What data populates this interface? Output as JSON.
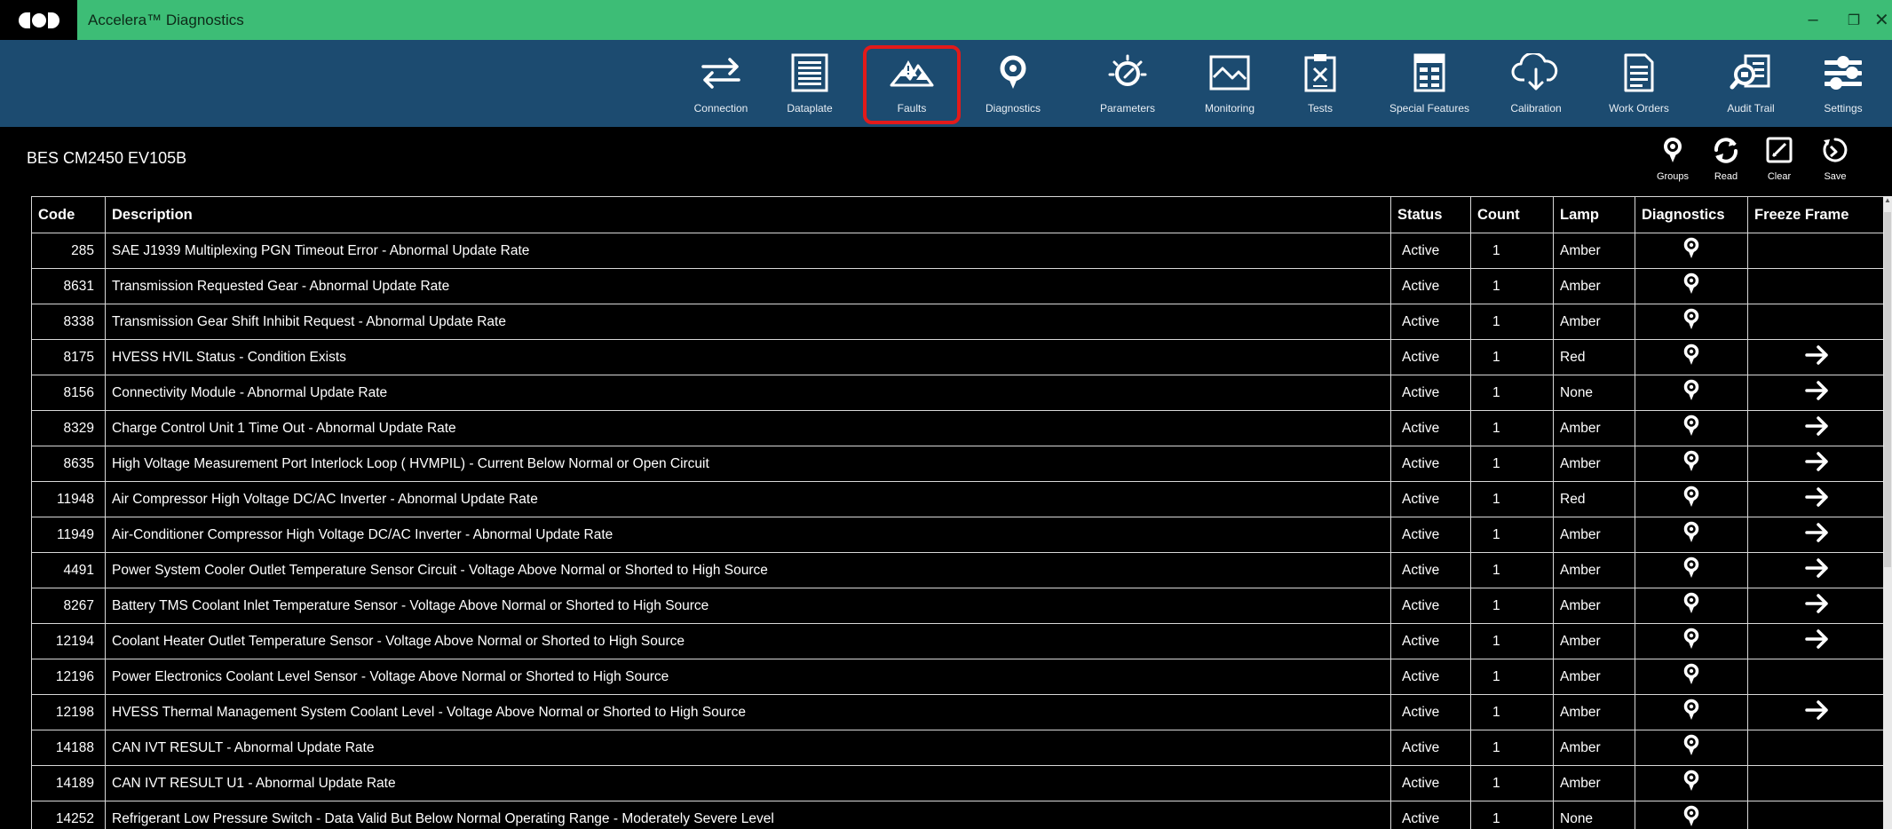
{
  "window": {
    "title": "Accelera™ Diagnostics",
    "controls": {
      "minimize": "–",
      "maximize": "❐",
      "close": "✕"
    }
  },
  "toolbar": {
    "items": [
      {
        "label": "Connection",
        "icon": "connection-arrows-icon"
      },
      {
        "label": "Dataplate",
        "icon": "dataplate-icon"
      },
      {
        "label": "Faults",
        "icon": "faults-icon",
        "active": true
      },
      {
        "label": "Diagnostics",
        "icon": "diagnostics-icon"
      },
      {
        "label": "Parameters",
        "icon": "parameters-gauge-icon"
      },
      {
        "label": "Monitoring",
        "icon": "monitoring-chart-icon"
      },
      {
        "label": "Tests",
        "icon": "tests-clipboard-icon"
      },
      {
        "label": "Special Features",
        "icon": "special-features-icon"
      },
      {
        "label": "Calibration",
        "icon": "calibration-cloud-icon"
      },
      {
        "label": "Work Orders",
        "icon": "work-orders-icon"
      },
      {
        "label": "Audit Trail",
        "icon": "audit-trail-icon"
      },
      {
        "label": "Settings",
        "icon": "settings-sliders-icon"
      }
    ],
    "highlight_color": "#e31a1a"
  },
  "subheader": {
    "ecm_label": "BES CM2450 EV105B",
    "actions": [
      {
        "label": "Groups",
        "icon": "groups-icon"
      },
      {
        "label": "Read",
        "icon": "refresh-icon"
      },
      {
        "label": "Clear",
        "icon": "clear-icon"
      },
      {
        "label": "Save",
        "icon": "save-icon"
      }
    ]
  },
  "table": {
    "headers": [
      "Code",
      "Description",
      "Status",
      "Count",
      "Lamp",
      "Diagnostics",
      "Freeze Frame"
    ],
    "rows": [
      {
        "code": "285",
        "description": "SAE J1939 Multiplexing PGN Timeout Error - Abnormal Update Rate",
        "status": "Active",
        "count": "1",
        "lamp": "Amber",
        "freeze_frame": false
      },
      {
        "code": "8631",
        "description": "Transmission Requested Gear - Abnormal Update Rate",
        "status": "Active",
        "count": "1",
        "lamp": "Amber",
        "freeze_frame": false
      },
      {
        "code": "8338",
        "description": "Transmission Gear Shift Inhibit Request - Abnormal Update Rate",
        "status": "Active",
        "count": "1",
        "lamp": "Amber",
        "freeze_frame": false
      },
      {
        "code": "8175",
        "description": "HVESS HVIL Status - Condition Exists",
        "status": "Active",
        "count": "1",
        "lamp": "Red",
        "freeze_frame": true
      },
      {
        "code": "8156",
        "description": "Connectivity Module - Abnormal Update Rate",
        "status": "Active",
        "count": "1",
        "lamp": "None",
        "freeze_frame": true
      },
      {
        "code": "8329",
        "description": "Charge Control Unit 1 Time Out - Abnormal Update Rate",
        "status": "Active",
        "count": "1",
        "lamp": "Amber",
        "freeze_frame": true
      },
      {
        "code": "8635",
        "description": "High Voltage Measurement Port Interlock Loop ( HVMPIL) - Current Below Normal or Open Circuit",
        "status": "Active",
        "count": "1",
        "lamp": "Amber",
        "freeze_frame": true
      },
      {
        "code": "11948",
        "description": "Air Compressor High Voltage DC/AC Inverter - Abnormal Update Rate",
        "status": "Active",
        "count": "1",
        "lamp": "Red",
        "freeze_frame": true
      },
      {
        "code": "11949",
        "description": "Air-Conditioner Compressor High Voltage DC/AC Inverter - Abnormal Update Rate",
        "status": "Active",
        "count": "1",
        "lamp": "Amber",
        "freeze_frame": true
      },
      {
        "code": "4491",
        "description": "Power System Cooler Outlet Temperature Sensor Circuit - Voltage Above Normal or Shorted to High Source",
        "status": "Active",
        "count": "1",
        "lamp": "Amber",
        "freeze_frame": true
      },
      {
        "code": "8267",
        "description": "Battery TMS Coolant Inlet Temperature Sensor - Voltage Above Normal or Shorted to High Source",
        "status": "Active",
        "count": "1",
        "lamp": "Amber",
        "freeze_frame": true
      },
      {
        "code": "12194",
        "description": "Coolant Heater Outlet Temperature Sensor - Voltage Above Normal or Shorted to High Source",
        "status": "Active",
        "count": "1",
        "lamp": "Amber",
        "freeze_frame": true
      },
      {
        "code": "12196",
        "description": "Power Electronics Coolant Level Sensor - Voltage Above Normal or Shorted to High Source",
        "status": "Active",
        "count": "1",
        "lamp": "Amber",
        "freeze_frame": false
      },
      {
        "code": "12198",
        "description": "HVESS Thermal Management System Coolant Level - Voltage Above Normal or Shorted to High Source",
        "status": "Active",
        "count": "1",
        "lamp": "Amber",
        "freeze_frame": true
      },
      {
        "code": "14188",
        "description": "CAN IVT RESULT - Abnormal Update Rate",
        "status": "Active",
        "count": "1",
        "lamp": "Amber",
        "freeze_frame": false
      },
      {
        "code": "14189",
        "description": "CAN IVT RESULT U1 - Abnormal Update Rate",
        "status": "Active",
        "count": "1",
        "lamp": "Amber",
        "freeze_frame": false
      },
      {
        "code": "14252",
        "description": "Refrigerant Low Pressure Switch - Data Valid But Below Normal Operating Range - Moderately Severe Level",
        "status": "Active",
        "count": "1",
        "lamp": "None",
        "freeze_frame": false
      }
    ]
  },
  "colors": {
    "titlebar": "#3dbd76",
    "toolbar": "#1c4b70",
    "background": "#000000",
    "grid_line": "#d8d8d8"
  }
}
